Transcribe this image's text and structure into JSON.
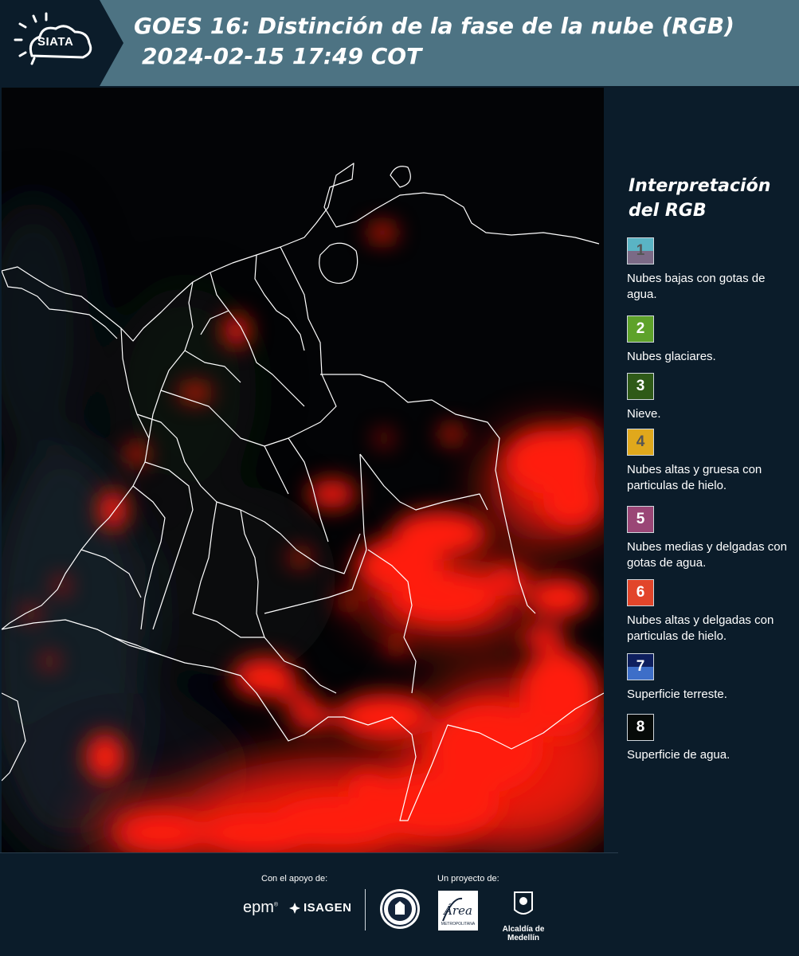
{
  "header": {
    "logo_text": "SIATA",
    "title_line1": "GOES 16: Distinción de la fase de la nube (RGB)",
    "title_line2": "2024-02-15 17:49 COT"
  },
  "legend": {
    "title_line1": "Interpretación",
    "title_line2": "del RGB",
    "items": [
      {
        "number": "1",
        "description": "Nubes bajas con gotas de agua.",
        "color_top": "#5ab4c4",
        "color_bottom": "#7b6a86",
        "num_color": "#555555"
      },
      {
        "number": "2",
        "description": "Nubes glaciares.",
        "color_top": "#5ea22a",
        "color_bottom": "#5ea22a",
        "num_color": "#ffffff"
      },
      {
        "number": "3",
        "description": "Nieve.",
        "color_top": "#2f5a18",
        "color_bottom": "#2f5a18",
        "num_color": "#ffffff"
      },
      {
        "number": "4",
        "description": "Nubes altas y gruesa con particulas de hielo.",
        "color_top": "#e0a81c",
        "color_bottom": "#e0a81c",
        "num_color": "#555555"
      },
      {
        "number": "5",
        "description": "Nubes medias y delgadas con gotas de agua.",
        "color_top": "#9a4676",
        "color_bottom": "#9a4676",
        "num_color": "#ffffff"
      },
      {
        "number": "6",
        "description": "Nubes altas y delgadas con particulas de hielo.",
        "color_top": "#e2452a",
        "color_bottom": "#e2452a",
        "num_color": "#ffffff"
      },
      {
        "number": "7",
        "description": "Superficie terreste.",
        "color_top": "#0e1f5e",
        "color_bottom": "#3d6ec8",
        "num_color": "#ffffff"
      },
      {
        "number": "8",
        "description": "Superficie de agua.",
        "color_top": "#060a08",
        "color_bottom": "#060a08",
        "num_color": "#ffffff"
      }
    ]
  },
  "footer": {
    "support_label": "Con el apoyo de:",
    "project_label": "Un proyecto de:",
    "epm_text": "epm",
    "isagen_text": "ISAGEN",
    "area_text": "Área",
    "area_sub": "METROPOLITANA",
    "alcaldia_label": "Alcaldía de Medellín"
  },
  "colors": {
    "header_bg": "#4d7383",
    "logo_bg": "#0b1c2a",
    "page_bg": "#0b1c2a",
    "cloud_red": "#ff1a10"
  }
}
